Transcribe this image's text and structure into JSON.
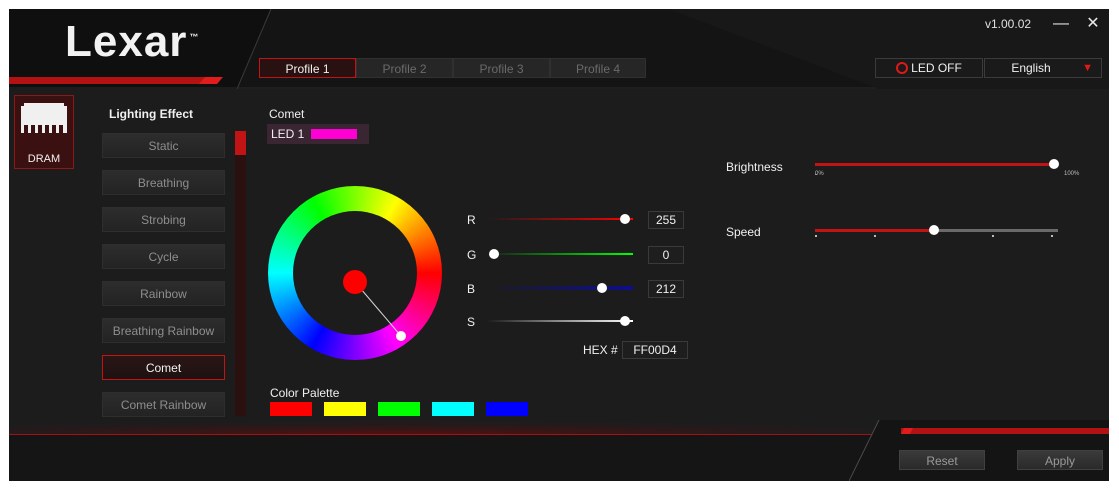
{
  "app": {
    "logo": "Lexar",
    "version": "v1.00.02"
  },
  "window": {
    "minimize": "—",
    "close": "✕"
  },
  "profiles": [
    "Profile 1",
    "Profile 2",
    "Profile 3",
    "Profile 4"
  ],
  "active_profile": 0,
  "header": {
    "led_off_label": "LED OFF",
    "language": "English"
  },
  "device": {
    "label": "DRAM"
  },
  "lighting": {
    "title": "Lighting Effect",
    "effects": [
      "Static",
      "Breathing",
      "Strobing",
      "Cycle",
      "Rainbow",
      "Breathing Rainbow",
      "Comet",
      "Comet Rainbow"
    ],
    "selected": "Comet"
  },
  "effect_panel": {
    "title": "Comet",
    "led_label": "LED 1",
    "led_color": "#ff00d4"
  },
  "rgb": {
    "r_label": "R",
    "r_value": "255",
    "g_label": "G",
    "g_value": "0",
    "b_label": "B",
    "b_value": "212",
    "s_label": "S",
    "hex_label": "HEX #",
    "hex_value": "FF00D4"
  },
  "palette": {
    "title": "Color Palette",
    "colors": [
      "#ff0000",
      "#ffff00",
      "#00ff00",
      "#00ffff",
      "#0000ff"
    ]
  },
  "sliders": {
    "brightness_label": "Brightness",
    "brightness_min": "0%",
    "brightness_max": "100%",
    "brightness_level": 1.0,
    "speed_label": "Speed",
    "speed_level": 0.5
  },
  "footer": {
    "reset": "Reset",
    "apply": "Apply"
  },
  "colors": {
    "accent": "#d01616",
    "background": "#1c1c1d"
  }
}
